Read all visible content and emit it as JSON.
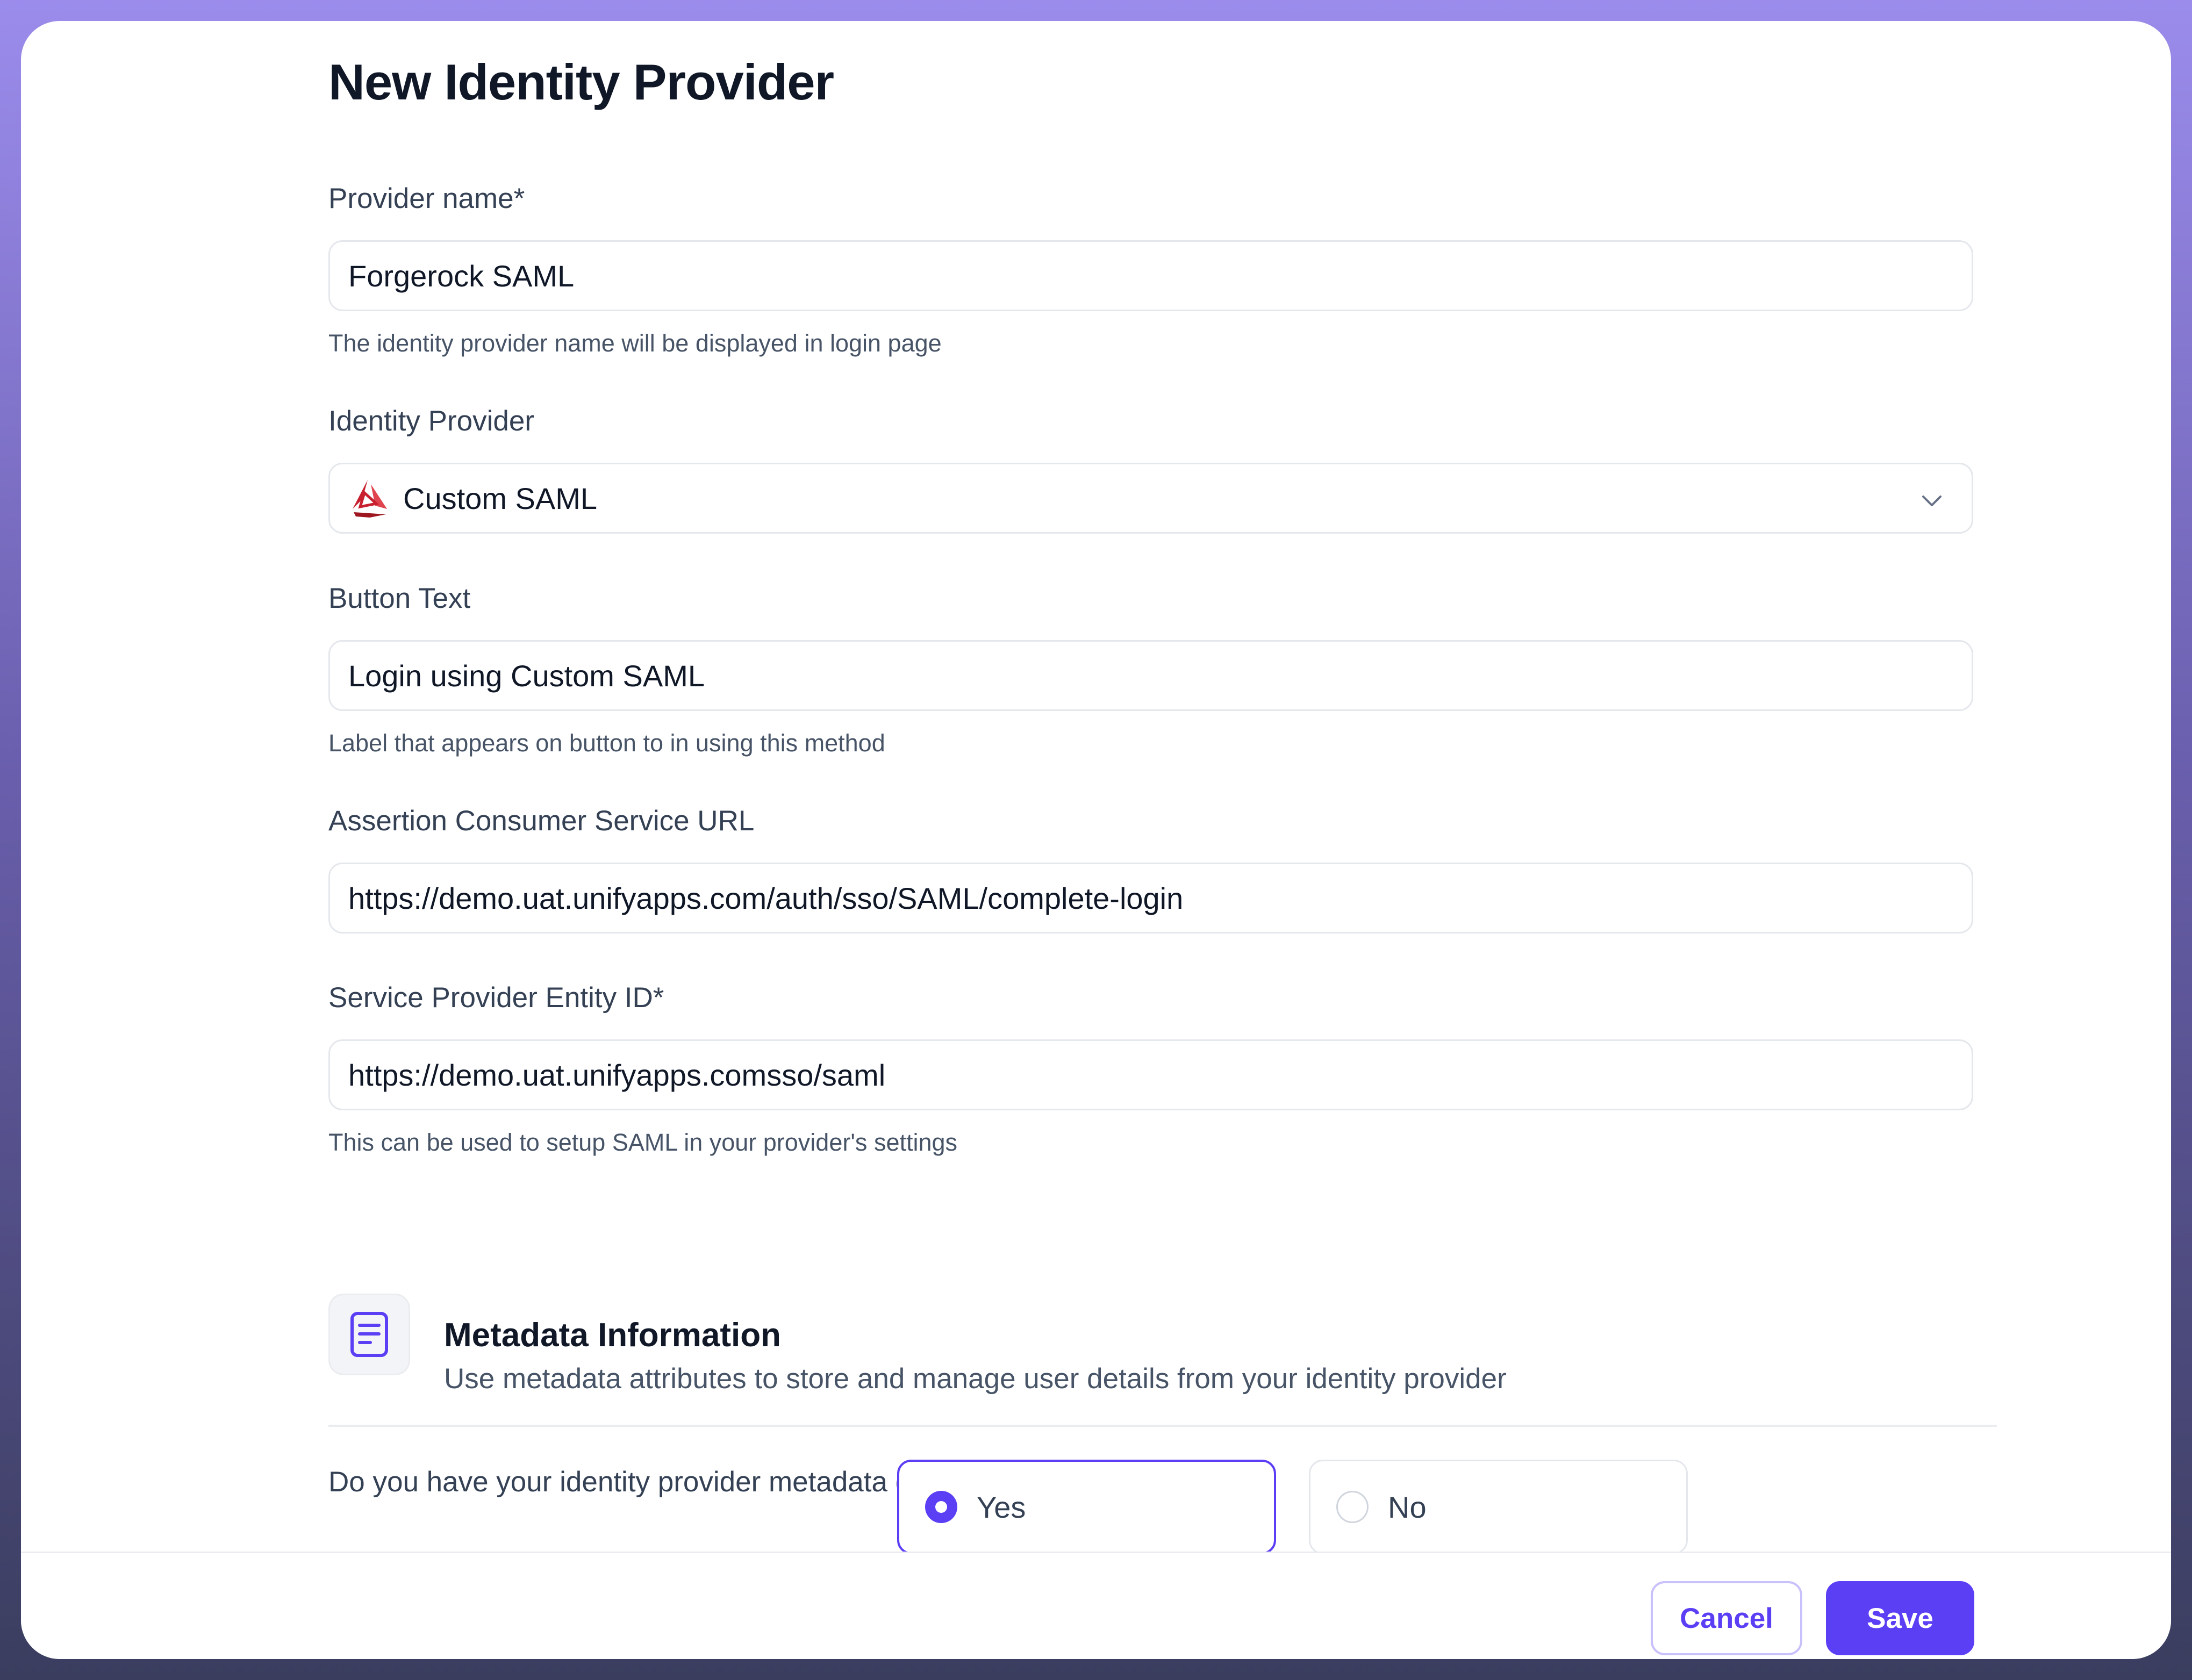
{
  "page": {
    "title": "New Identity Provider"
  },
  "form": {
    "provider_name": {
      "label": "Provider name*",
      "value": "Forgerock SAML",
      "hint": "The identity provider name will be displayed in login page"
    },
    "identity_provider": {
      "label": "Identity Provider",
      "value": "Custom SAML",
      "icon": "custom-saml-logo-icon"
    },
    "button_text": {
      "label": "Button Text",
      "value": "Login using Custom SAML",
      "hint": "Label that appears on button to in using this method"
    },
    "acs_url": {
      "label": "Assertion Consumer Service URL",
      "value": "https://demo.uat.unifyapps.com/auth/sso/SAML/complete-login"
    },
    "sp_entity_id": {
      "label": "Service Provider Entity ID*",
      "value": "https://demo.uat.unifyapps.comsso/saml",
      "hint": "This can be used to setup SAML in your provider's settings"
    }
  },
  "metadata": {
    "icon": "document-icon",
    "title": "Metadata Information",
    "subtitle": "Use metadata attributes to store and manage user details from your identity provider",
    "question": "Do you have your identity provider metadata content?*",
    "options": [
      {
        "label": "Yes",
        "selected": true
      },
      {
        "label": "No",
        "selected": false
      }
    ]
  },
  "footer": {
    "cancel_label": "Cancel",
    "save_label": "Save"
  },
  "colors": {
    "accent": "#5b3ff5",
    "text": "#101828",
    "border": "#e4e7ec"
  }
}
